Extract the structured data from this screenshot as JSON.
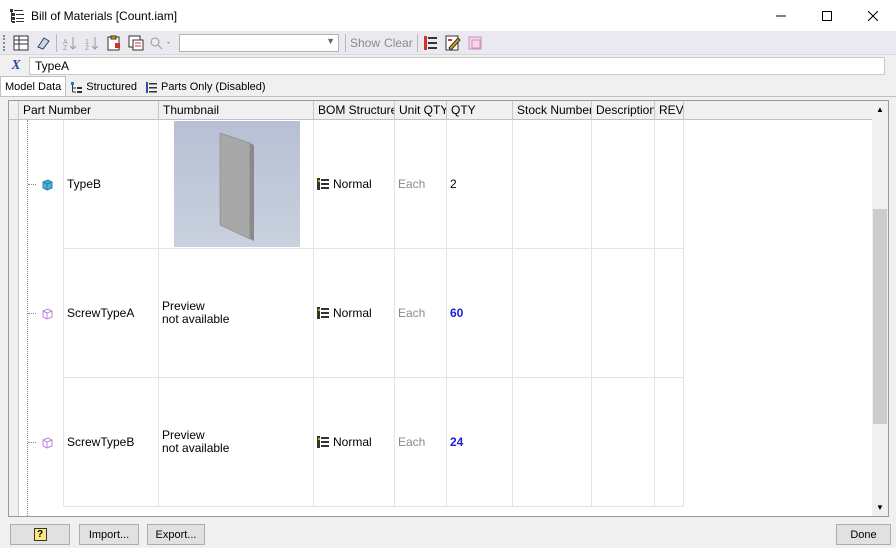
{
  "window": {
    "title": "Bill of Materials [Count.iam]",
    "icon": "bom-icon",
    "controls": [
      "minimize-icon",
      "maximize-icon",
      "close-icon"
    ]
  },
  "toolbar": {
    "combo_value": "",
    "show_label": "Show",
    "clear_label": "Clear"
  },
  "name_bar": {
    "icon_label": "X",
    "value": "TypeA"
  },
  "tabs": [
    {
      "label": "Model Data",
      "active": true
    },
    {
      "label": "Structured",
      "icon": "structured-icon"
    },
    {
      "label": "Parts Only (Disabled)",
      "icon": "parts-only-icon"
    }
  ],
  "columns": [
    "Part Number",
    "Thumbnail",
    "BOM Structure",
    "Unit QTY",
    "QTY",
    "Stock Number",
    "Description",
    "REV"
  ],
  "rows": [
    {
      "part_number": "TypeB",
      "icon": "part-icon",
      "thumbnail": "image",
      "bom_structure": "Normal",
      "unit_qty": "Each",
      "qty": "2",
      "qty_highlight": false
    },
    {
      "part_number": "ScrewTypeA",
      "icon": "virtual-part-icon",
      "thumbnail_line1": "Preview",
      "thumbnail_line2": "not available",
      "bom_structure": "Normal",
      "unit_qty": "Each",
      "qty": "60",
      "qty_highlight": true
    },
    {
      "part_number": "ScrewTypeB",
      "icon": "virtual-part-icon",
      "thumbnail_line1": "Preview",
      "thumbnail_line2": "not available",
      "bom_structure": "Normal",
      "unit_qty": "Each",
      "qty": "24",
      "qty_highlight": true
    }
  ],
  "footer": {
    "help_label": "?",
    "import_label": "Import...",
    "export_label": "Export...",
    "done_label": "Done"
  },
  "colors": {
    "qty_highlight": "#1d1dd4",
    "toolbar_bg": "#e9e9ef"
  }
}
